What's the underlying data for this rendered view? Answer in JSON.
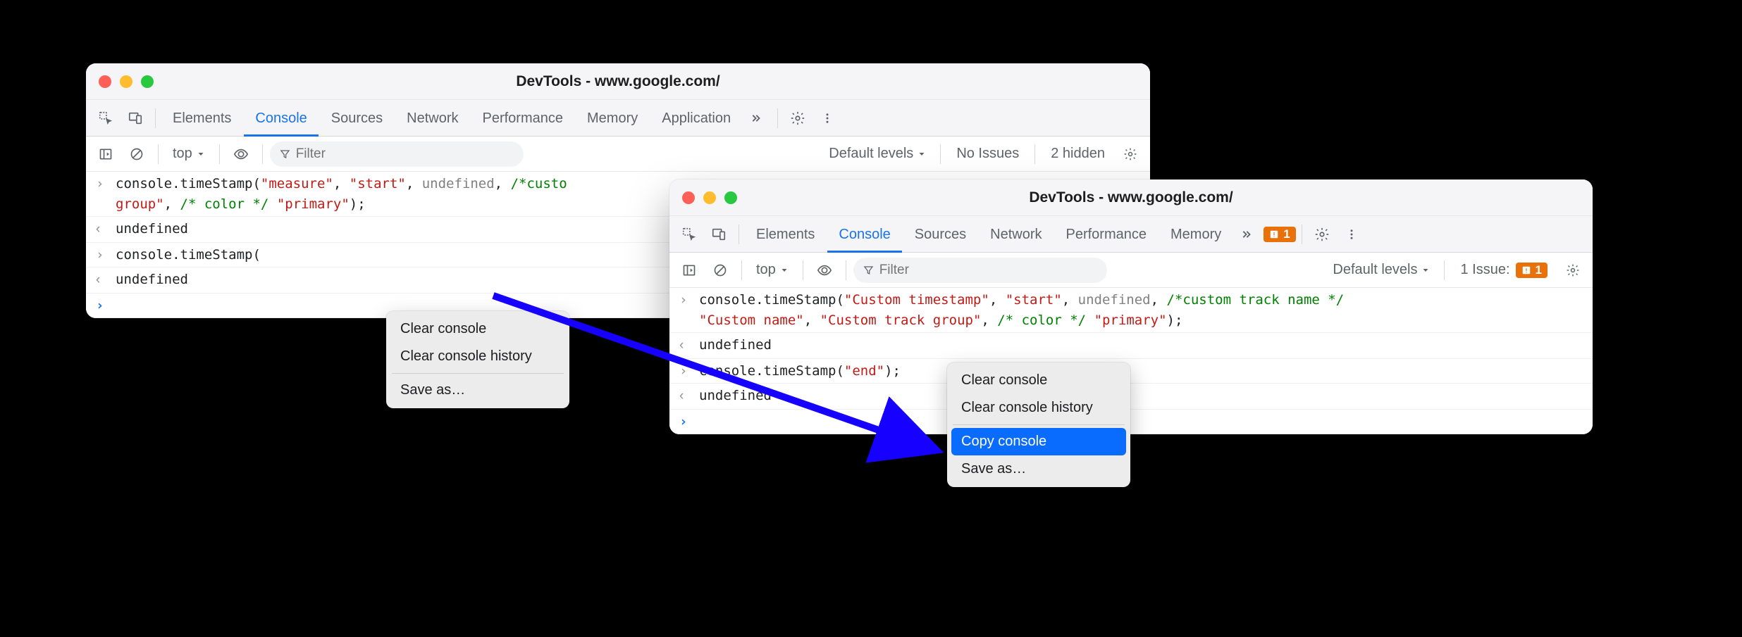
{
  "window1": {
    "title": "DevTools - www.google.com/",
    "tabs": [
      "Elements",
      "Console",
      "Sources",
      "Network",
      "Performance",
      "Memory",
      "Application"
    ],
    "activeTab": "Console",
    "toolbar": {
      "context": "top",
      "filterPlaceholder": "Filter",
      "levels": "Default levels",
      "issues": "No Issues",
      "hidden": "2 hidden"
    },
    "logs": {
      "line1_parts": {
        "p1": "console.timeStamp(",
        "s1": "\"measure\"",
        "c1": ", ",
        "s2": "\"start\"",
        "c2": ", ",
        "kw1": "undefined",
        "c3": ", ",
        "cmt1": "/*custo",
        "c4": "group\"",
        "c5": ", ",
        "cmt2": "/* color */",
        "c6": " ",
        "s3": "\"primary\"",
        "c7": ");"
      },
      "line2": "undefined",
      "line3": "console.timeStamp(",
      "line4": "undefined"
    },
    "menu": {
      "clear": "Clear console",
      "history": "Clear console history",
      "saveas": "Save as…"
    }
  },
  "window2": {
    "title": "DevTools - www.google.com/",
    "tabs": [
      "Elements",
      "Console",
      "Sources",
      "Network",
      "Performance",
      "Memory"
    ],
    "activeTab": "Console",
    "issueCountTab": "1",
    "toolbar": {
      "context": "top",
      "filterPlaceholder": "Filter",
      "levels": "Default levels",
      "issues": "1 Issue:",
      "issueCount": "1"
    },
    "logs": {
      "line1_parts": {
        "p1": "console.timeStamp(",
        "s1": "\"Custom timestamp\"",
        "c1": ", ",
        "s2": "\"start\"",
        "c2": ", ",
        "kw1": "undefined",
        "c3": ", ",
        "cmt1": "/*custom track name */",
        "nl": "\n",
        "s3": "\"Custom name\"",
        "c4": ", ",
        "s4": "\"Custom track group\"",
        "c5": ", ",
        "cmt2": "/* color */",
        "c6": " ",
        "s5": "\"primary\"",
        "c7": ");"
      },
      "line2": "undefined",
      "line3_parts": {
        "p1": "console.timeStamp(",
        "s1": "\"end\"",
        "c1": ");"
      },
      "line4": "undefined"
    },
    "menu": {
      "clear": "Clear console",
      "history": "Clear console history",
      "copy": "Copy console",
      "saveas": "Save as…"
    }
  }
}
